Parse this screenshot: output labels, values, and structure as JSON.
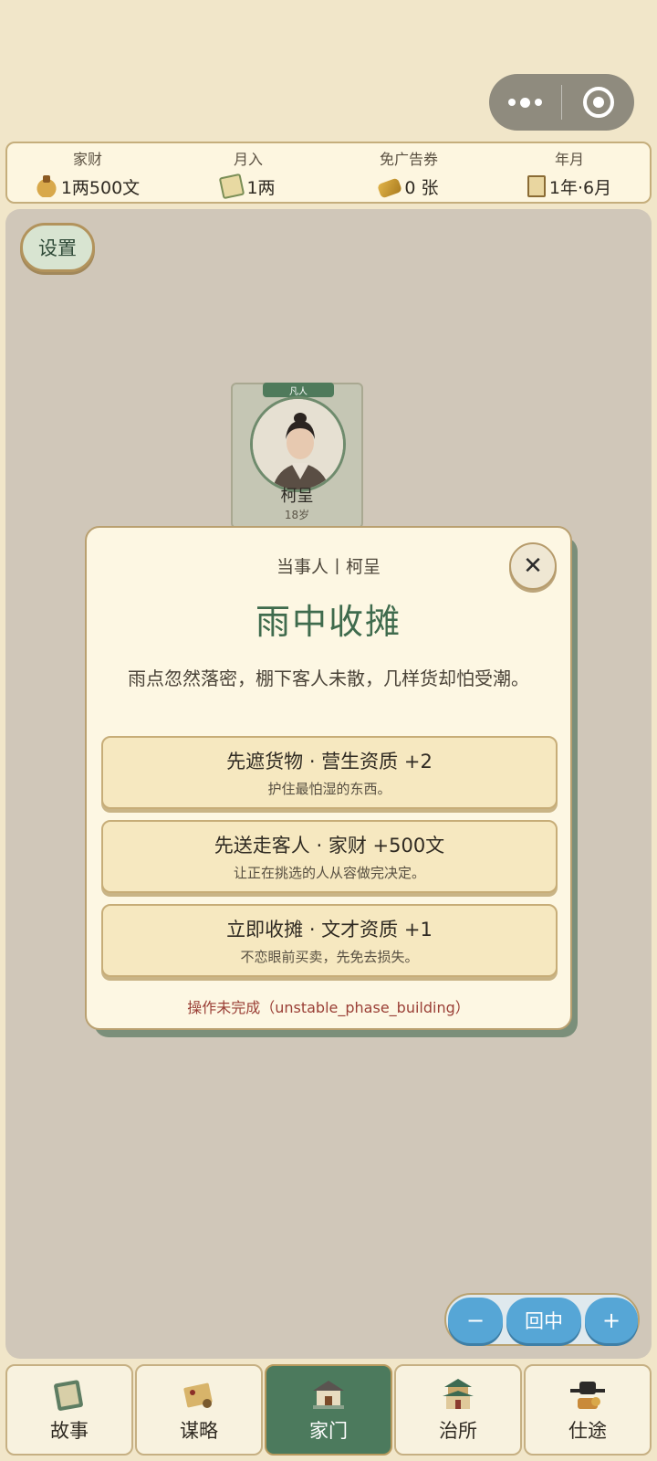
{
  "capsule": {
    "more_icon": "more-dots-icon",
    "close_icon": "target-circle-icon"
  },
  "stats": [
    {
      "label": "家财",
      "value": "1两500文",
      "icon": "money-bag-icon"
    },
    {
      "label": "月入",
      "value": "1两",
      "icon": "income-scroll-icon"
    },
    {
      "label": "免广告券",
      "value": "0 张",
      "icon": "gold-ticket-icon"
    },
    {
      "label": "年月",
      "value": "1年·6月",
      "icon": "calendar-scroll-icon"
    }
  ],
  "settings_label": "设置",
  "person": {
    "tag": "凡人",
    "name": "柯呈",
    "age": "18岁"
  },
  "modal": {
    "subtitle": "当事人丨柯呈",
    "title": "雨中收摊",
    "description": "雨点忽然落密，棚下客人未散，几样货却怕受潮。",
    "close": "✕",
    "options": [
      {
        "title": "先遮货物 · 营生资质 +2",
        "desc": "护住最怕湿的东西。"
      },
      {
        "title": "先送走客人 · 家财 +500文",
        "desc": "让正在挑选的人从容做完决定。"
      },
      {
        "title": "立即收摊 · 文才资质 +1",
        "desc": "不恋眼前买卖，先免去损失。"
      }
    ],
    "error": "操作未完成（unstable_phase_building）"
  },
  "zoom": {
    "minus": "−",
    "center": "回中",
    "plus": "+"
  },
  "nav": [
    {
      "label": "故事",
      "icon": "story-book-icon",
      "active": false
    },
    {
      "label": "谋略",
      "icon": "strategy-board-icon",
      "active": false
    },
    {
      "label": "家门",
      "icon": "house-icon",
      "active": true
    },
    {
      "label": "治所",
      "icon": "pavilion-icon",
      "active": false
    },
    {
      "label": "仕途",
      "icon": "official-hat-icon",
      "active": false
    }
  ],
  "colors": {
    "accent": "#4c7a5d",
    "title": "#3f6b4d",
    "error": "#9a3f36",
    "zoom": "#56a6d6"
  }
}
